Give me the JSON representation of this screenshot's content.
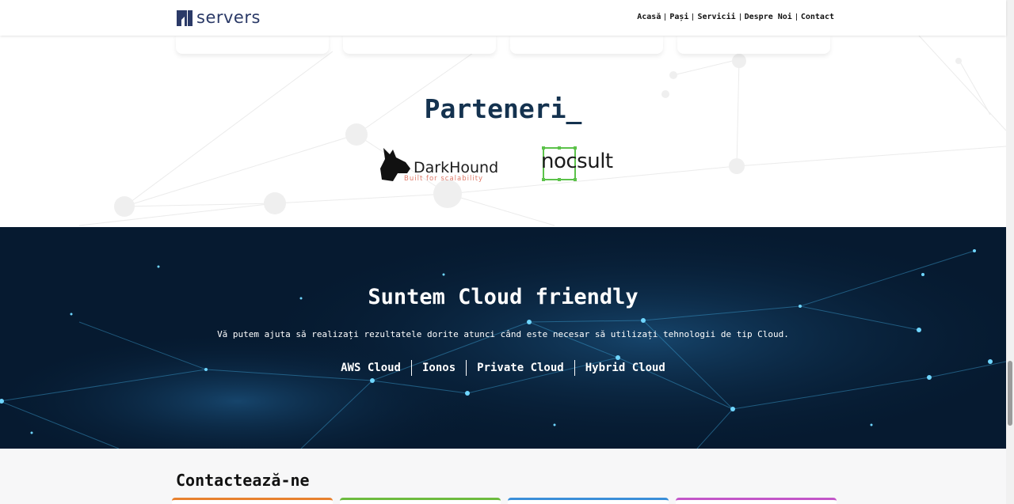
{
  "header": {
    "logo_text": "servers",
    "nav": [
      "Acasă",
      "Pași",
      "Servicii",
      "Despre Noi",
      "Contact"
    ]
  },
  "partners": {
    "title": "Parteneri_",
    "darkhound": {
      "name": "DarkHound",
      "tagline": "Built for scalability"
    },
    "nocsult": {
      "name": "nocsult"
    }
  },
  "cloud": {
    "title": "Suntem Cloud friendly",
    "subtitle": "Vă putem ajuta să realizați rezultatele dorite atunci când este necesar să utilizați tehnologii de tip Cloud.",
    "items": [
      "AWS Cloud",
      "Ionos",
      "Private Cloud",
      "Hybrid Cloud"
    ]
  },
  "contact": {
    "title": "Contactează-ne",
    "card_colors": [
      "#e8812f",
      "#6dbb3f",
      "#3a8fd9",
      "#c356c9"
    ]
  },
  "colors": {
    "brand": "#2b3a67",
    "title_dark": "#14324f",
    "cloud_bg": "#061a30"
  }
}
